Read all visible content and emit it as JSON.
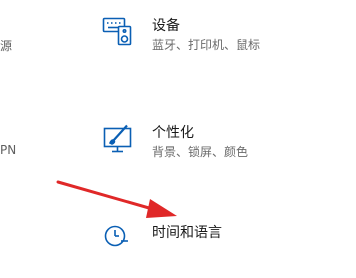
{
  "left_fragments": {
    "top": "源",
    "bottom": "PN"
  },
  "tiles": [
    {
      "icon": "devices-icon",
      "title": "设备",
      "desc": "蓝牙、打印机、鼠标"
    },
    {
      "icon": "personalization-icon",
      "title": "个性化",
      "desc": "背景、锁屏、颜色"
    },
    {
      "icon": "time-language-icon",
      "title": "时间和语言",
      "desc": ""
    }
  ],
  "colors": {
    "icon": "#0a5fb4",
    "arrow": "#e02828"
  }
}
